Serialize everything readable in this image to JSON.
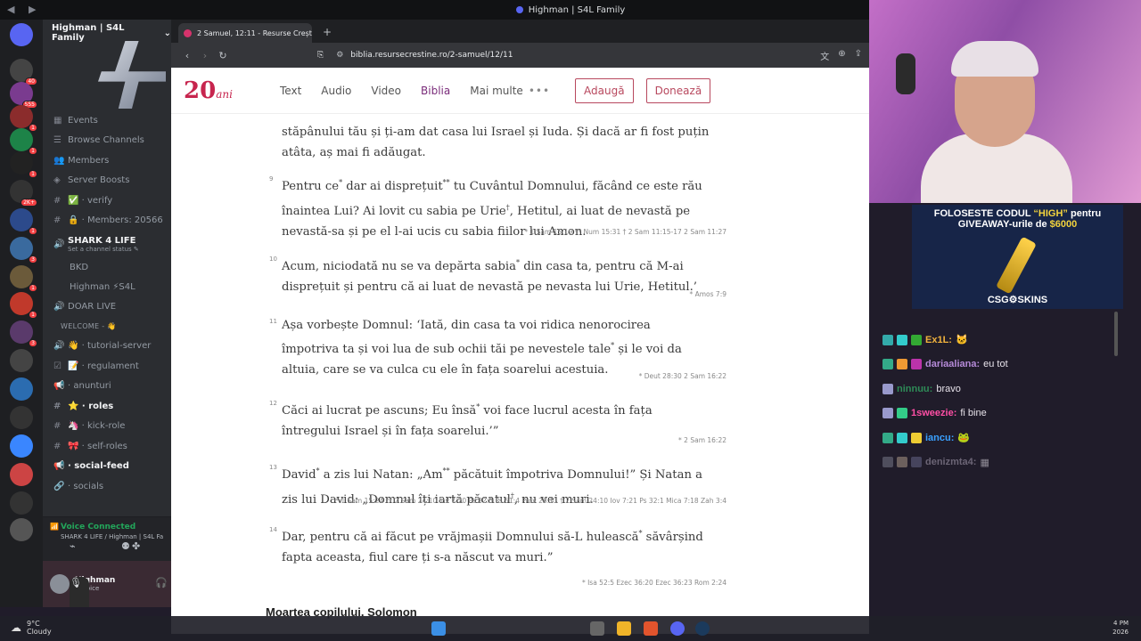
{
  "window": {
    "title": "Highman | S4L Family"
  },
  "rail": {
    "badges": [
      "40",
      "555",
      "1",
      "1",
      "1",
      "2K+",
      "1",
      "3",
      "1",
      "1",
      "3",
      "2"
    ]
  },
  "discord": {
    "server_name": "Highman | S4L Family",
    "channels": [
      {
        "icon": "calendar-icon",
        "label": "Events",
        "bold": false
      },
      {
        "icon": "browse-icon",
        "label": "Browse Channels",
        "bold": false
      },
      {
        "icon": "members-icon",
        "label": "Members",
        "bold": false
      },
      {
        "icon": "boost-icon",
        "label": "Server Boosts",
        "bold": false
      },
      {
        "icon": "hash-icon",
        "label": "✅ · verify",
        "bold": false
      },
      {
        "icon": "hash-icon",
        "label": "🔒 · Members: 20566",
        "bold": false
      },
      {
        "icon": "speaker-icon",
        "label": "SHARK 4 LIFE",
        "bold": true,
        "status": "Set a channel status ✎"
      },
      {
        "icon": "",
        "label": "BKD",
        "bold": false,
        "sub": true
      },
      {
        "icon": "",
        "label": "Highman ⚡S4L",
        "bold": false,
        "sub": true
      },
      {
        "icon": "speaker-icon",
        "label": "DOAR LIVE",
        "bold": false
      },
      {
        "icon": "",
        "label": "WELCOME - 👋",
        "bold": false,
        "category": true
      },
      {
        "icon": "speaker-icon",
        "label": "👋 · tutorial-server",
        "bold": false
      },
      {
        "icon": "rules-icon",
        "label": "📝 · regulament",
        "bold": false
      },
      {
        "icon": "announce-icon",
        "label": "· anunturi",
        "bold": false
      },
      {
        "icon": "hash-icon",
        "label": "⭐ · roles",
        "bold": true
      },
      {
        "icon": "hash-icon",
        "label": "🦄 · kick-role",
        "bold": false
      },
      {
        "icon": "hash-icon",
        "label": "🎀 · self-roles",
        "bold": false
      },
      {
        "icon": "announce-icon",
        "label": "· social-feed",
        "bold": true
      },
      {
        "icon": "link-icon",
        "label": "· socials",
        "bold": false
      }
    ],
    "voice": {
      "status": "Voice Connected",
      "channel": "SHARK 4 LIFE / Highman | S4L Fa..."
    },
    "user": {
      "name": "Highman",
      "status": "In voice"
    }
  },
  "browser": {
    "tab_title": "2 Samuel, 12:11 - Resurse Crești",
    "url": "biblia.resursecrestine.ro/2-samuel/12/11"
  },
  "site": {
    "brand": "20",
    "brand_sub": "ani",
    "nav": [
      "Text",
      "Audio",
      "Video",
      "Biblia",
      "Mai multe"
    ],
    "nav_active": "Biblia",
    "more_dots": "•••",
    "btn_add": "Adaugă",
    "btn_donate": "Donează"
  },
  "verses": [
    {
      "num": "",
      "html": "stăpânului tău și ți-am dat casa lui Israel și Iuda. Și dacă ar fi fost puțin atâta, aș mai fi adăugat.",
      "refs": ""
    },
    {
      "num": "9",
      "html": "Pentru ce<sup>*</sup> dar ai disprețuit<sup>**</sup> tu Cuvântul Domnului, făcând ce este rău înaintea Lui? Ai lovit cu sabia pe Urie<sup>†</sup>, Hetitul, ai luat de nevastă pe nevastă-sa și pe el l-ai ucis cu sabia fiilor lui Amon.",
      "refs": "* 1 Sam 15:19 ** Num 15:31 † 2 Sam 11:15-17 2 Sam 11:27"
    },
    {
      "num": "10",
      "html": "Acum, niciodată nu se va depărta sabia<sup>*</sup> din casa ta, pentru că M-ai disprețuit și pentru că ai luat de nevastă pe nevasta lui Urie, Hetitul.’",
      "refs": "* Amos 7:9"
    },
    {
      "num": "11",
      "html": "Așa vorbește Domnul: ‘Iată, din casa ta voi ridica nenorocirea împotriva ta și voi lua de sub ochii tăi pe nevestele tale<sup>*</sup> și le voi da altuia, care se va culca cu ele în fața soarelui acestuia.",
      "refs": "* Deut 28:30 2 Sam 16:22"
    },
    {
      "num": "12",
      "html": "Căci ai lucrat pe ascuns; Eu însă<sup>*</sup> voi face lucrul acesta în fața întregului Israel și în fața soarelui.’”",
      "refs": "* 2 Sam 16:22"
    },
    {
      "num": "13",
      "html": "David<sup>*</sup> a zis lui Natan: „Am<sup>**</sup> păcătuit împotriva Domnului!” Și Natan a zis lui David: „Domnul îți iartă păcatul<sup>†</sup>, nu vei muri.",
      "refs": "* 1 Sam 15:24 ** 2 Sam 24:10 Iov 7:20 Ps 32:5 Ps 51:4 Prov 28:13 † 2 Sam 24:10 Iov 7:21 Ps 32:1 Mica 7:18 Zah 3:4"
    },
    {
      "num": "14",
      "html": "Dar, pentru că ai făcut pe vrăjmașii Domnului să-L hulească<sup>*</sup> săvârșind fapta aceasta, fiul care ți s-a născut va muri.”",
      "refs": "* Isa 52:5 Ezec 36:20 Ezec 36:23 Rom 2:24"
    }
  ],
  "section_heading": "Moartea copilului. Solomon",
  "ad": {
    "line1_a": "FOLOSESTE CODUL ",
    "line1_b": "“HIGH”",
    "line1_c": " pentru",
    "line2_a": "GIVEAWAY-urile de ",
    "line2_b": "$6000",
    "logo": "CSG⚙SKINS"
  },
  "chat": [
    {
      "user": "Ex1L:",
      "msg": "🐱",
      "color": "#f2b33d",
      "badges": [
        "#3aa",
        "#3cc",
        "#3a3"
      ]
    },
    {
      "user": "dariaaliana:",
      "msg": "eu tot",
      "color": "#b58ad8",
      "badges": [
        "#3a8",
        "#e93",
        "#b3a"
      ]
    },
    {
      "user": "ninnuu:",
      "msg": "bravo",
      "color": "#2e8b57",
      "badges": [
        "#99c"
      ]
    },
    {
      "user": "1sweezie:",
      "msg": "fi bine",
      "color": "#ff4fa6",
      "badges": [
        "#99c",
        "#3c8"
      ]
    },
    {
      "user": "iancu:",
      "msg": "🐸",
      "color": "#3aa0ff",
      "badges": [
        "#3a8",
        "#3cc",
        "#ec3"
      ]
    },
    {
      "user": "denizmta4:",
      "msg": "▦",
      "color": "#a9a0b3",
      "badges": [
        "#778",
        "#a98",
        "#668"
      ]
    }
  ],
  "taskbar": {
    "temp": "9°C",
    "weather": "Cloudy",
    "time": "4 PM",
    "date": "2026"
  }
}
